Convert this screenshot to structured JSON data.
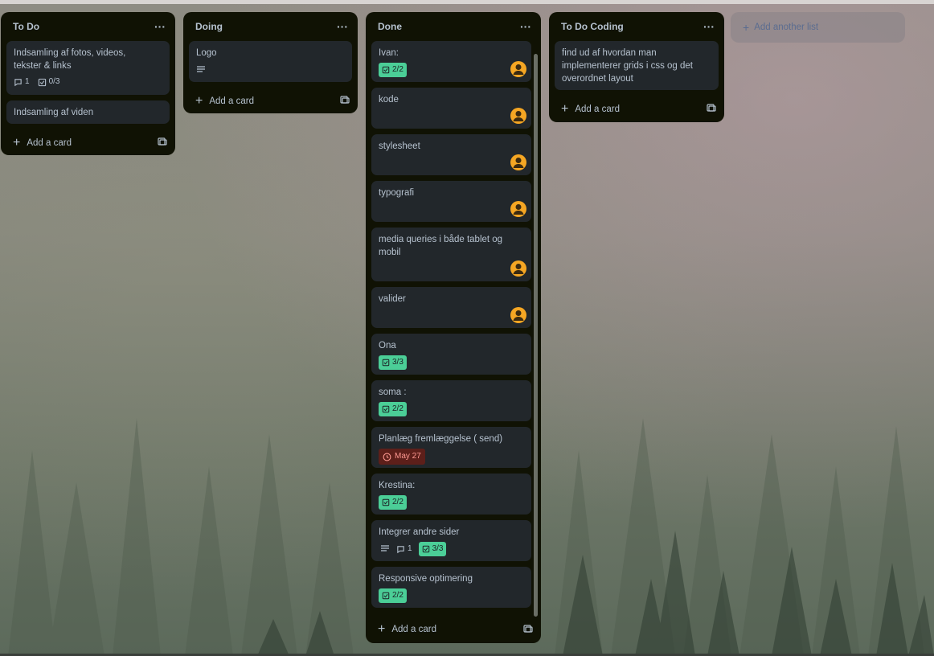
{
  "board": {
    "add_list_label": "Add another list",
    "add_card_label": "Add a card",
    "colors": {
      "list_bg": "#101204",
      "card_bg": "#22272b",
      "text": "#b6c2cf",
      "badge_green": "#4bce97",
      "badge_red_bg": "#5d1f1a",
      "badge_red_text": "#fd9891",
      "avatar": "#f5a623"
    }
  },
  "lists": [
    {
      "title": "To Do",
      "cards": [
        {
          "title": "Indsamling af fotos, videos, tekster & links",
          "comments": "1",
          "checklist": "0/3"
        },
        {
          "title": "Indsamling af viden"
        }
      ]
    },
    {
      "title": "Doing",
      "cards": [
        {
          "title": "Logo",
          "has_description": true
        }
      ]
    },
    {
      "title": "Done",
      "cards": [
        {
          "title": "Ivan:",
          "checklist": "2/2",
          "avatar": true
        },
        {
          "title": "kode",
          "avatar": true
        },
        {
          "title": "stylesheet",
          "avatar": true
        },
        {
          "title": "typografi",
          "avatar": true
        },
        {
          "title": "media queries i både tablet og mobil",
          "avatar": true
        },
        {
          "title": "valider",
          "avatar": true
        },
        {
          "title": "Ona",
          "checklist": "3/3"
        },
        {
          "title": "soma :",
          "checklist": "2/2"
        },
        {
          "title": "Planlæg fremlæggelse ( send)",
          "due": "May 27"
        },
        {
          "title": "Krestina:",
          "checklist": "2/2"
        },
        {
          "title": "Integrer andre sider",
          "has_description": true,
          "comments": "1",
          "checklist": "3/3"
        },
        {
          "title": "Responsive optimering",
          "checklist": "2/2"
        }
      ]
    },
    {
      "title": "To Do Coding",
      "cards": [
        {
          "title": "find ud af hvordan man implementerer grids i css og det overordnet layout"
        }
      ]
    }
  ]
}
